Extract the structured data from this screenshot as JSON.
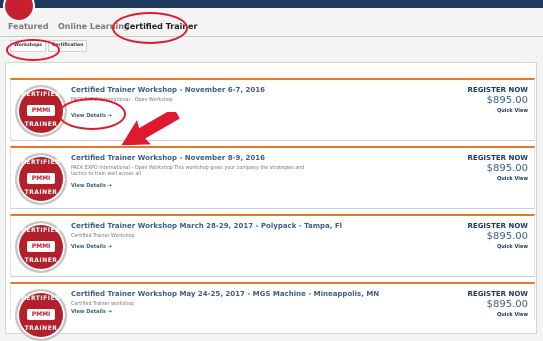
{
  "header": {
    "tabs": [
      {
        "label": "Featured"
      },
      {
        "label": "Online Learning"
      },
      {
        "label": "Certified Trainer"
      }
    ],
    "subtabs": [
      {
        "label": "Workshops"
      },
      {
        "label": "Certification"
      }
    ]
  },
  "badge": {
    "top": "CERTIFIED",
    "middle": "PMMI",
    "bottom": "TRAINER"
  },
  "cards": [
    {
      "title": "Certified Trainer Workshop - November 6-7, 2016",
      "description": "PACK EXPO International - Open Workshop",
      "details": "View Details",
      "register": "REGISTER NOW",
      "price": "$895.00",
      "quick_view": "Quick View"
    },
    {
      "title": "Certified Trainer Workshop - November 8-9, 2016",
      "description": "PACK EXPO International - Open Workshop This workshop gives your company the strategies and tactics to train well across all",
      "details": "View Details",
      "register": "REGISTER NOW",
      "price": "$895.00",
      "quick_view": "Quick View"
    },
    {
      "title": "Certified Trainer Workshop March 28-29, 2017 - Polypack - Tampa, Fl",
      "description": "Certified Trainer Workshop",
      "details": "View Details",
      "register": "REGISTER NOW",
      "price": "$895.00",
      "quick_view": "Quick View"
    },
    {
      "title": "Certified Trainer Workshop May 24-25, 2017 - MGS Machine - Mineappolis, MN",
      "description": "Certified Trainer workshop",
      "details": "View Details",
      "register": "REGISTER NOW",
      "price": "$895.00",
      "quick_view": "Quick View"
    }
  ],
  "annotations": {
    "ring_color": "#e1192f",
    "arrow_color": "#e1192f"
  }
}
